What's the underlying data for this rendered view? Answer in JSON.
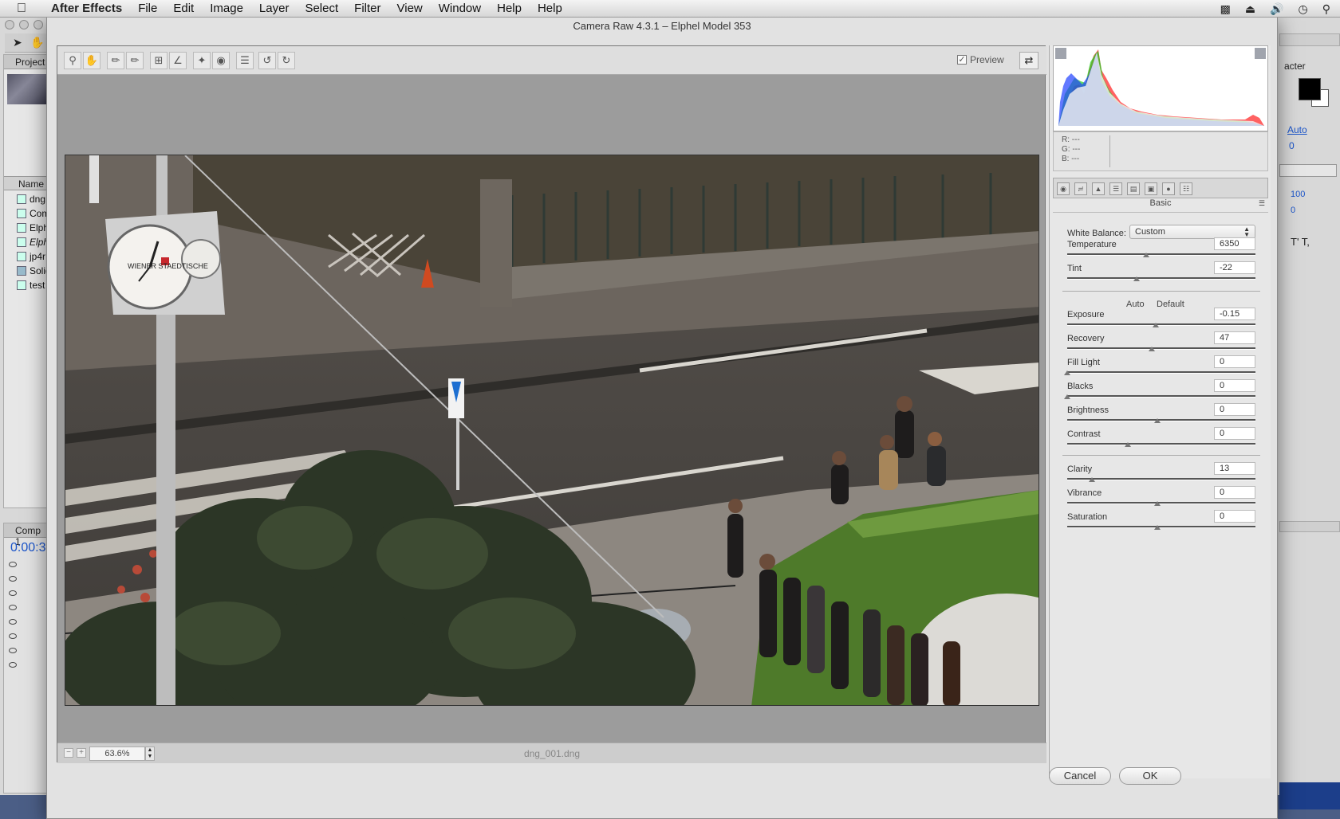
{
  "menubar": {
    "app": "After Effects",
    "items": [
      "File",
      "Edit",
      "Image",
      "Layer",
      "Select",
      "Filter",
      "View",
      "Window",
      "Help",
      "Help"
    ]
  },
  "ae": {
    "project_tab": "Project",
    "name_header": "Name",
    "project_items": [
      "dng",
      "Com",
      "Elph",
      "Elph",
      "jp4r",
      "Solid",
      "test"
    ],
    "comp_tab": "Comp 1",
    "timecode": "0:00:3",
    "right": {
      "panel_title": "acter",
      "auto_label": "Auto",
      "zero_value": "0",
      "pct_1": "100",
      "pct_2": "0",
      "text_icons": "T' T,"
    }
  },
  "dialog": {
    "title": "Camera Raw 4.3.1  –  Elphel Model 353",
    "preview_label": "Preview",
    "zoom_value": "63.6%",
    "file_name": "dng_001.dng",
    "cancel_label": "Cancel",
    "ok_label": "OK"
  },
  "panel": {
    "rgb": {
      "r": "R:  ---",
      "g": "G:  ---",
      "b": "B:  ---"
    },
    "section_title": "Basic",
    "white_balance_label": "White Balance:",
    "white_balance_value": "Custom",
    "auto_label": "Auto",
    "default_label": "Default",
    "sliders": {
      "temperature": {
        "label": "Temperature",
        "value": "6350",
        "level": 0.42
      },
      "tint": {
        "label": "Tint",
        "value": "-22",
        "level": 0.37
      },
      "exposure": {
        "label": "Exposure",
        "value": "-0.15",
        "level": 0.47
      },
      "recovery": {
        "label": "Recovery",
        "value": "47",
        "level": 0.45
      },
      "fill_light": {
        "label": "Fill Light",
        "value": "0",
        "level": 0.0
      },
      "blacks": {
        "label": "Blacks",
        "value": "0",
        "level": 0.0
      },
      "brightness": {
        "label": "Brightness",
        "value": "0",
        "level": 0.48
      },
      "contrast": {
        "label": "Contrast",
        "value": "0",
        "level": 0.32
      },
      "clarity": {
        "label": "Clarity",
        "value": "13",
        "level": 0.13
      },
      "vibrance": {
        "label": "Vibrance",
        "value": "0",
        "level": 0.48
      },
      "saturation": {
        "label": "Saturation",
        "value": "0",
        "level": 0.48
      }
    }
  },
  "photo": {
    "sign_text": "WIENER STAEDTISCHE"
  },
  "colors": {
    "accent_blue": "#1a54c9",
    "grass": "#4e7a2a",
    "asphalt": "#4a4744"
  }
}
